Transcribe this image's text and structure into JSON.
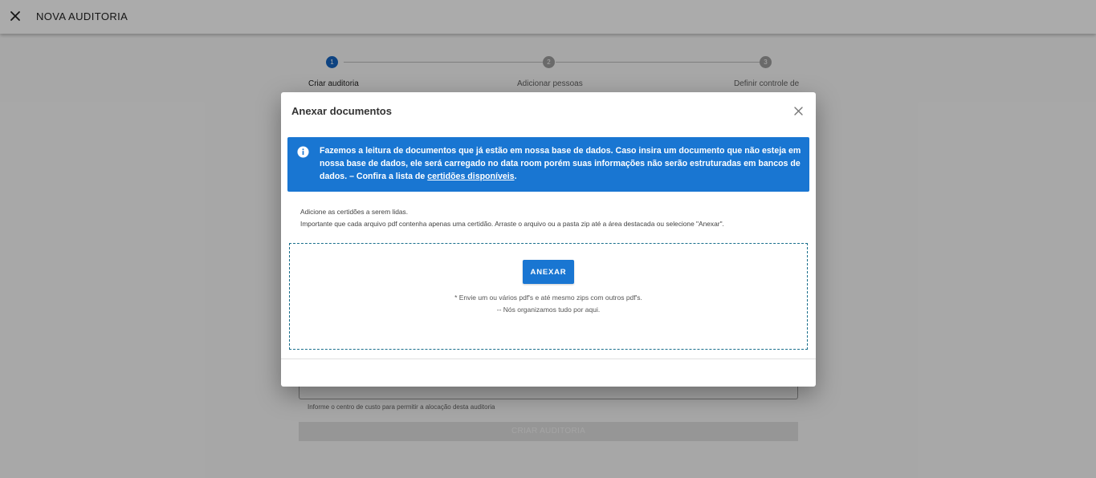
{
  "topbar": {
    "close_icon": "close-icon",
    "title": "NOVA AUDITORIA"
  },
  "stepper": {
    "steps": [
      {
        "number": "1",
        "label": "Criar auditoria",
        "state": "active"
      },
      {
        "number": "2",
        "label": "Adicionar pessoas",
        "state": "inactive"
      },
      {
        "number": "3",
        "label": "Definir controle de",
        "state": "inactive"
      }
    ]
  },
  "background_form": {
    "helper_text": "Informe o centro de custo para permitir a alocação desta auditoria",
    "submit_label": "CRIAR AUDITORIA"
  },
  "dialog": {
    "title": "Anexar documentos",
    "close_icon": "close-icon",
    "info": {
      "icon": "info-icon",
      "text": "Fazemos a leitura de documentos que já estão em nossa base de dados. Caso insira um documento que não esteja em nossa base de dados, ele será carregado no data room porém suas informações não serão estruturadas em bancos de dados. – Confira a lista de ",
      "link_text": "certidões disponíveis",
      "text_end": "."
    },
    "instructions": {
      "line1": "Adicione as certidões a serem lidas.",
      "line2": "Importante que cada arquivo pdf contenha apenas uma certidão. Arraste o arquivo ou a pasta zip até a área destacada ou selecione \"Anexar\"."
    },
    "drop_zone": {
      "button_label": "ANEXAR",
      "note1": "* Envie um ou vários pdf's e até mesmo zips com outros pdf's.",
      "note2": "-- Nós organizamos tudo por aqui."
    }
  },
  "colors": {
    "primary": "#1976d2",
    "step_active": "#1565c0",
    "step_inactive": "#9e9e9e",
    "drop_border": "#1a6f8c",
    "overlay": "rgba(0,0,0,0.33)"
  }
}
